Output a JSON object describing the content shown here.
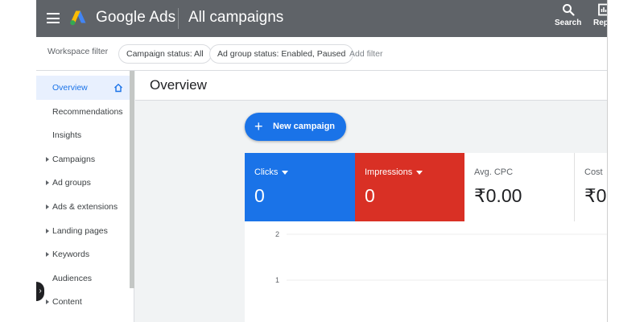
{
  "header": {
    "brand": "Google Ads",
    "page_title": "All campaigns",
    "actions": [
      {
        "label": "Search",
        "icon": "search-icon"
      },
      {
        "label": "Repo",
        "icon": "reports-icon"
      }
    ]
  },
  "filters": {
    "label": "Workspace filter",
    "chips": [
      "Campaign status: All",
      "Ad group status: Enabled, Paused"
    ],
    "add_label": "Add filter"
  },
  "sidebar": {
    "items": [
      {
        "label": "Overview",
        "active": true,
        "expandable": false
      },
      {
        "label": "Recommendations",
        "active": false,
        "expandable": false
      },
      {
        "label": "Insights",
        "active": false,
        "expandable": false
      },
      {
        "label": "Campaigns",
        "active": false,
        "expandable": true
      },
      {
        "label": "Ad groups",
        "active": false,
        "expandable": true
      },
      {
        "label": "Ads & extensions",
        "active": false,
        "expandable": true
      },
      {
        "label": "Landing pages",
        "active": false,
        "expandable": true
      },
      {
        "label": "Keywords",
        "active": false,
        "expandable": true
      },
      {
        "label": "Audiences",
        "active": false,
        "expandable": false
      },
      {
        "label": "Content",
        "active": false,
        "expandable": true
      }
    ]
  },
  "main": {
    "title": "Overview",
    "new_campaign_label": "New campaign",
    "metrics": [
      {
        "label": "Clicks",
        "value": "0",
        "dropdown": true,
        "color": "#1a73e8"
      },
      {
        "label": "Impressions",
        "value": "0",
        "dropdown": true,
        "color": "#d93025"
      },
      {
        "label": "Avg. CPC",
        "value": "₹0.00",
        "dropdown": false
      },
      {
        "label": "Cost",
        "value": "₹0",
        "dropdown": false
      }
    ],
    "chart": {
      "y_ticks": [
        "2",
        "1"
      ]
    }
  },
  "colors": {
    "header_bg": "#5f6368",
    "accent_blue": "#1a73e8",
    "accent_red": "#d93025"
  }
}
